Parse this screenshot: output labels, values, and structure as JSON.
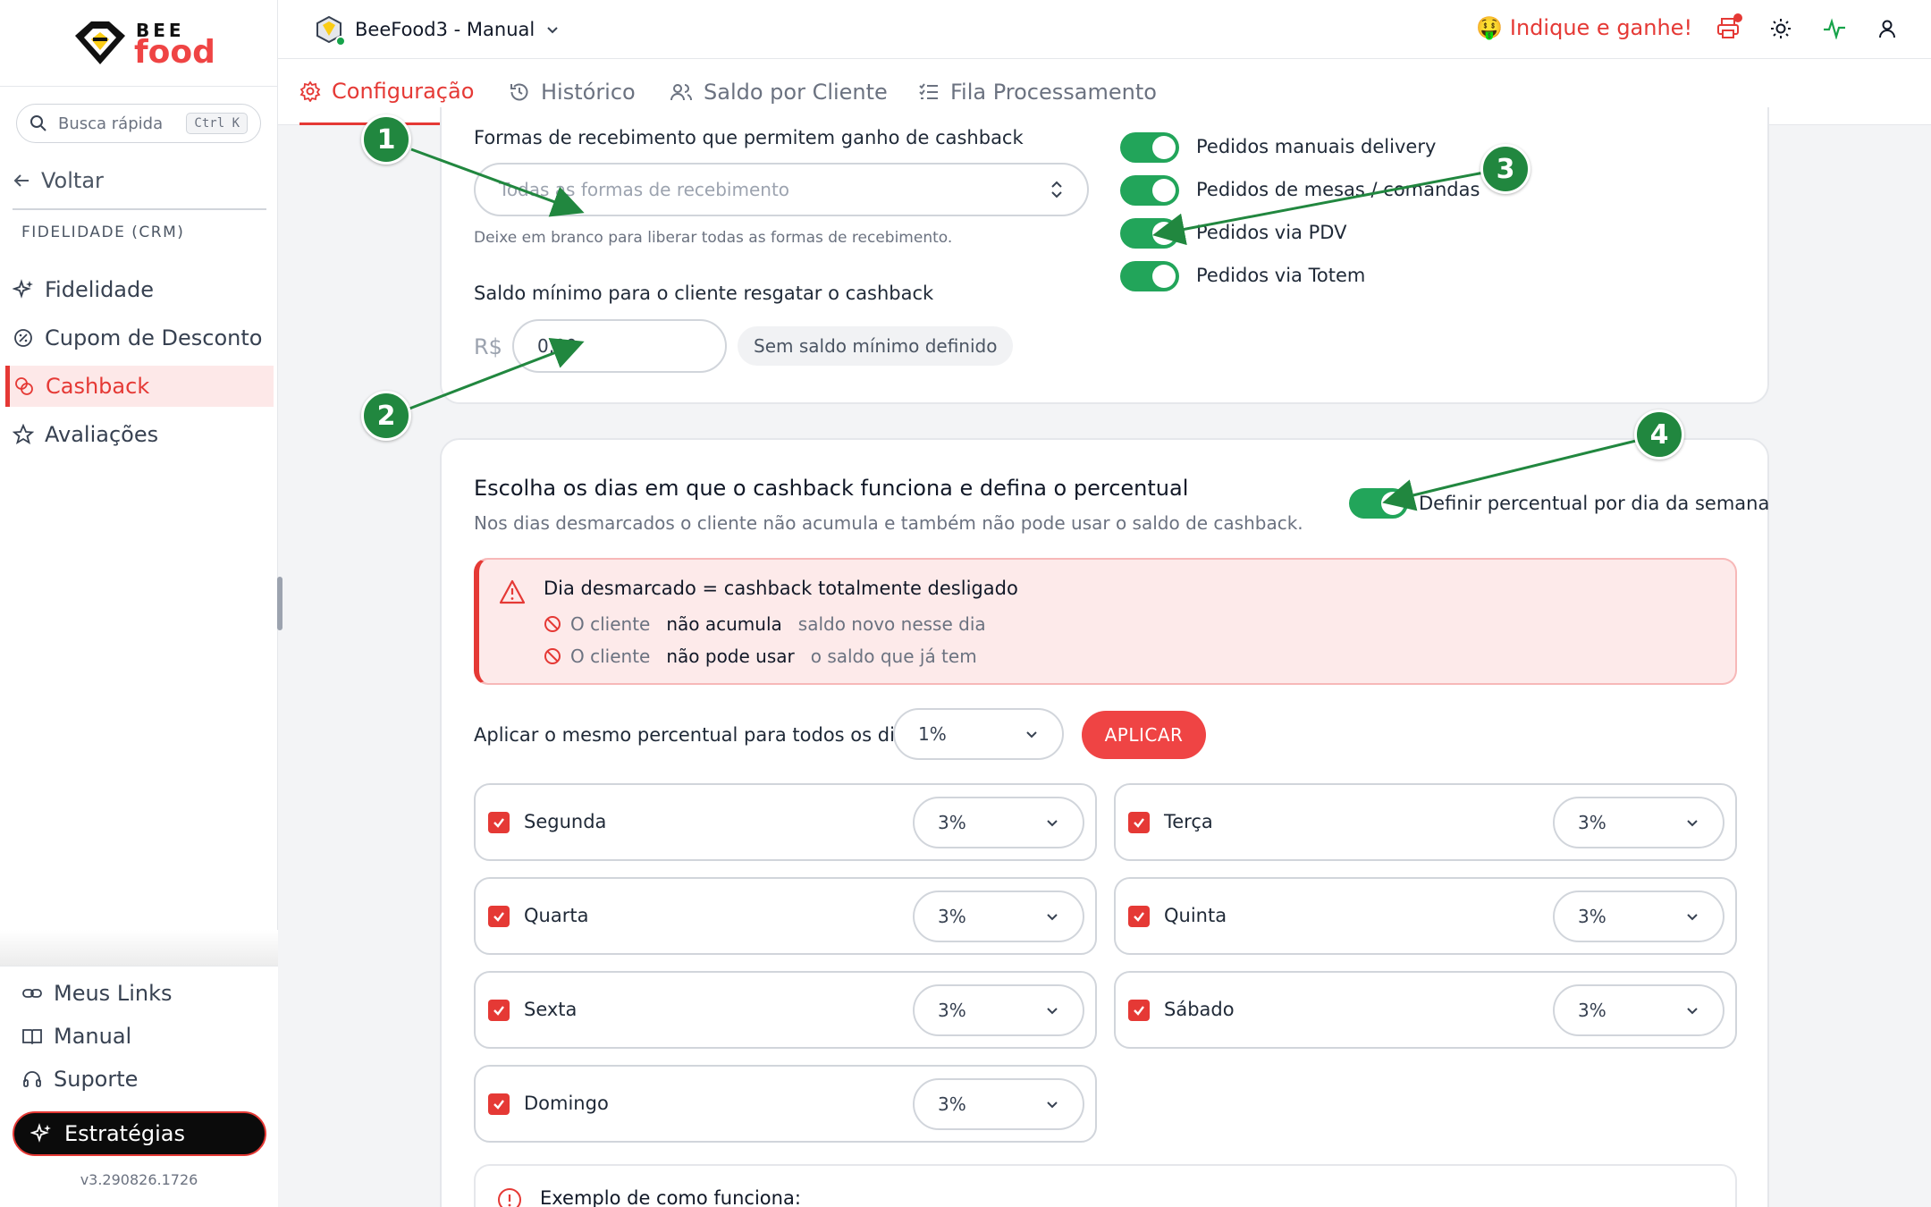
{
  "sidebar": {
    "logo_top": "BEE",
    "logo_bottom": "food",
    "search_placeholder": "Busca rápida",
    "search_kbd": "Ctrl K",
    "back_label": "Voltar",
    "section_label": "FIDELIDADE (CRM)",
    "items": [
      {
        "label": "Fidelidade",
        "icon": "sparkle-icon"
      },
      {
        "label": "Cupom de Desconto",
        "icon": "discount-icon"
      },
      {
        "label": "Cashback",
        "icon": "coins-icon",
        "active": true
      },
      {
        "label": "Avaliações",
        "icon": "star-icon"
      }
    ],
    "bottom_items": [
      {
        "label": "Meus Links",
        "icon": "link-icon"
      },
      {
        "label": "Manual",
        "icon": "book-icon"
      },
      {
        "label": "Suporte",
        "icon": "headset-icon"
      }
    ],
    "strategies_label": "Estratégias",
    "version": "v3.290826.1726"
  },
  "topbar": {
    "store_name": "BeeFood3 - Manual",
    "refer_label": "Indique e ganhe!",
    "refer_emoji": "🤑"
  },
  "tabs": [
    {
      "label": "Configuração",
      "active": true
    },
    {
      "label": "Histórico"
    },
    {
      "label": "Saldo por Cliente"
    },
    {
      "label": "Fila Processamento"
    }
  ],
  "card1": {
    "payment_label": "Formas de recebimento que permitem ganho de cashback",
    "payment_placeholder": "Todas as formas de recebimento",
    "payment_hint": "Deixe em branco para liberar todas as formas de recebimento.",
    "min_balance_label": "Saldo mínimo para o cliente resgatar o cashback",
    "currency": "R$",
    "min_balance_value": "0,00",
    "min_balance_badge": "Sem saldo mínimo definido",
    "toggles": [
      {
        "label": "Pedidos manuais delivery",
        "on": true
      },
      {
        "label": "Pedidos de mesas / comandas",
        "on": true
      },
      {
        "label": "Pedidos via PDV",
        "on": true
      },
      {
        "label": "Pedidos via Totem",
        "on": true
      }
    ]
  },
  "card2": {
    "title": "Escolha os dias em que o cashback funciona e defina o percentual",
    "subtitle": "Nos dias desmarcados o cliente não acumula e também não pode usar o saldo de cashback.",
    "per_day_toggle_label": "Definir percentual por dia da semana",
    "alert": {
      "title": "Dia desmarcado = cashback totalmente desligado",
      "row1_pre": "O cliente",
      "row1_bold": "não acumula",
      "row1_post": "saldo novo nesse dia",
      "row2_pre": "O cliente",
      "row2_bold": "não pode usar",
      "row2_post": "o saldo que já tem"
    },
    "apply_all_label": "Aplicar o mesmo percentual para todos os dias",
    "apply_all_value": "1%",
    "apply_button": "APLICAR",
    "days": [
      {
        "name": "Segunda",
        "value": "3%",
        "checked": true
      },
      {
        "name": "Terça",
        "value": "3%",
        "checked": true
      },
      {
        "name": "Quarta",
        "value": "3%",
        "checked": true
      },
      {
        "name": "Quinta",
        "value": "3%",
        "checked": true
      },
      {
        "name": "Sexta",
        "value": "3%",
        "checked": true
      },
      {
        "name": "Sábado",
        "value": "3%",
        "checked": true
      },
      {
        "name": "Domingo",
        "value": "3%",
        "checked": true
      }
    ],
    "example_title": "Exemplo de como funciona:"
  },
  "annotations": [
    "1",
    "2",
    "3",
    "4"
  ],
  "colors": {
    "accent": "#e53935",
    "toggle_on": "#22a55a",
    "annotation": "#21873f"
  }
}
